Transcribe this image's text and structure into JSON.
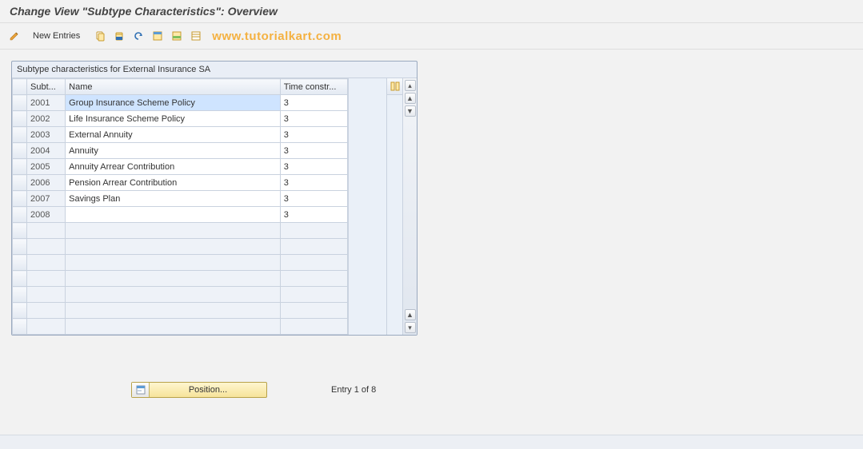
{
  "title": "Change View \"Subtype Characteristics\": Overview",
  "toolbar": {
    "new_entries_label": "New Entries"
  },
  "watermark": "www.tutorialkart.com",
  "table": {
    "heading": "Subtype characteristics for External Insurance  SA",
    "cols": {
      "subt": "Subt...",
      "name": "Name",
      "time": "Time constr..."
    },
    "rows": [
      {
        "subt": "2001",
        "name": "Group Insurance Scheme Policy",
        "time": "3"
      },
      {
        "subt": "2002",
        "name": "Life Insurance Scheme Policy",
        "time": "3"
      },
      {
        "subt": "2003",
        "name": "External Annuity",
        "time": "3"
      },
      {
        "subt": "2004",
        "name": "Annuity",
        "time": "3"
      },
      {
        "subt": "2005",
        "name": "Annuity Arrear Contribution",
        "time": "3"
      },
      {
        "subt": "2006",
        "name": "Pension Arrear Contribution",
        "time": "3"
      },
      {
        "subt": "2007",
        "name": "Savings Plan",
        "time": "3"
      },
      {
        "subt": "2008",
        "name": "",
        "time": "3"
      }
    ],
    "empty_rows": 7
  },
  "footer": {
    "position_label": "Position...",
    "entry_label": "Entry 1 of 8"
  }
}
